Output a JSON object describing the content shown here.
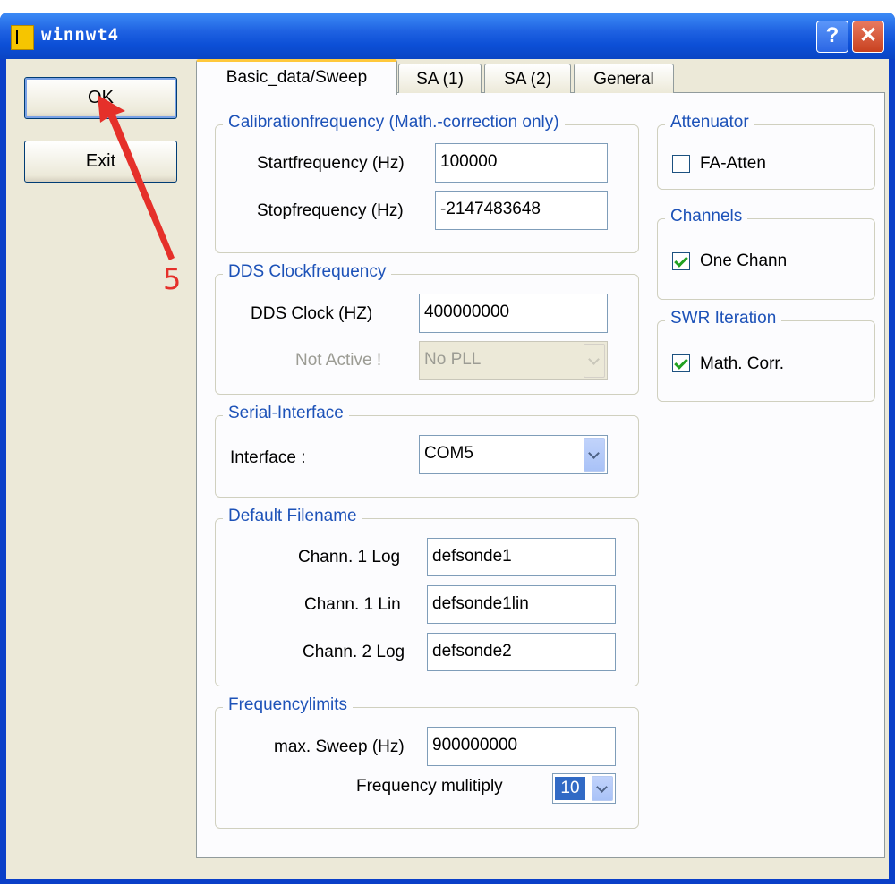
{
  "window": {
    "title": "winnwt4",
    "help_glyph": "?",
    "close_glyph": "✕"
  },
  "buttons": {
    "ok": "OK",
    "exit": "Exit"
  },
  "tabs": [
    {
      "label": "Basic_data/Sweep",
      "active": true
    },
    {
      "label": "SA (1)",
      "active": false
    },
    {
      "label": "SA (2)",
      "active": false
    },
    {
      "label": "General",
      "active": false
    }
  ],
  "calibration": {
    "title": "Calibrationfrequency (Math.-correction only)",
    "start_label": "Startfrequency (Hz)",
    "start_value": "100000",
    "stop_label": "Stopfrequency (Hz)",
    "stop_value": "-2147483648"
  },
  "dds": {
    "title": "DDS Clockfrequency",
    "clock_label": "DDS Clock (HZ)",
    "clock_value": "400000000",
    "pll_label": "Not Active !",
    "pll_value": "No PLL"
  },
  "serial": {
    "title": "Serial-Interface",
    "interface_label": "Interface :",
    "interface_value": "COM5"
  },
  "filenames": {
    "title": "Default Filename",
    "rows": [
      {
        "label": "Chann. 1  Log",
        "value": "defsonde1"
      },
      {
        "label": "Chann. 1  Lin",
        "value": "defsonde1lin"
      },
      {
        "label": "Chann. 2 Log",
        "value": "defsonde2"
      }
    ]
  },
  "limits": {
    "title": "Frequencylimits",
    "sweep_label": "max. Sweep (Hz)",
    "sweep_value": "900000000",
    "multiply_label": "Frequency mulitiply",
    "multiply_value": "10"
  },
  "attenuator": {
    "title": "Attenuator",
    "label": "FA-Atten",
    "checked": false
  },
  "channels": {
    "title": "Channels",
    "label": "One Chann",
    "checked": true
  },
  "swr": {
    "title": "SWR Iteration",
    "label": "Math. Corr.",
    "checked": true
  },
  "annotation": {
    "number": "5",
    "color": "#e5302a"
  },
  "colors": {
    "titlebar": "#0c4fd6",
    "group_title": "#1d52b8",
    "dialog_bg": "#ece9d8",
    "check_mark": "#21a121"
  }
}
